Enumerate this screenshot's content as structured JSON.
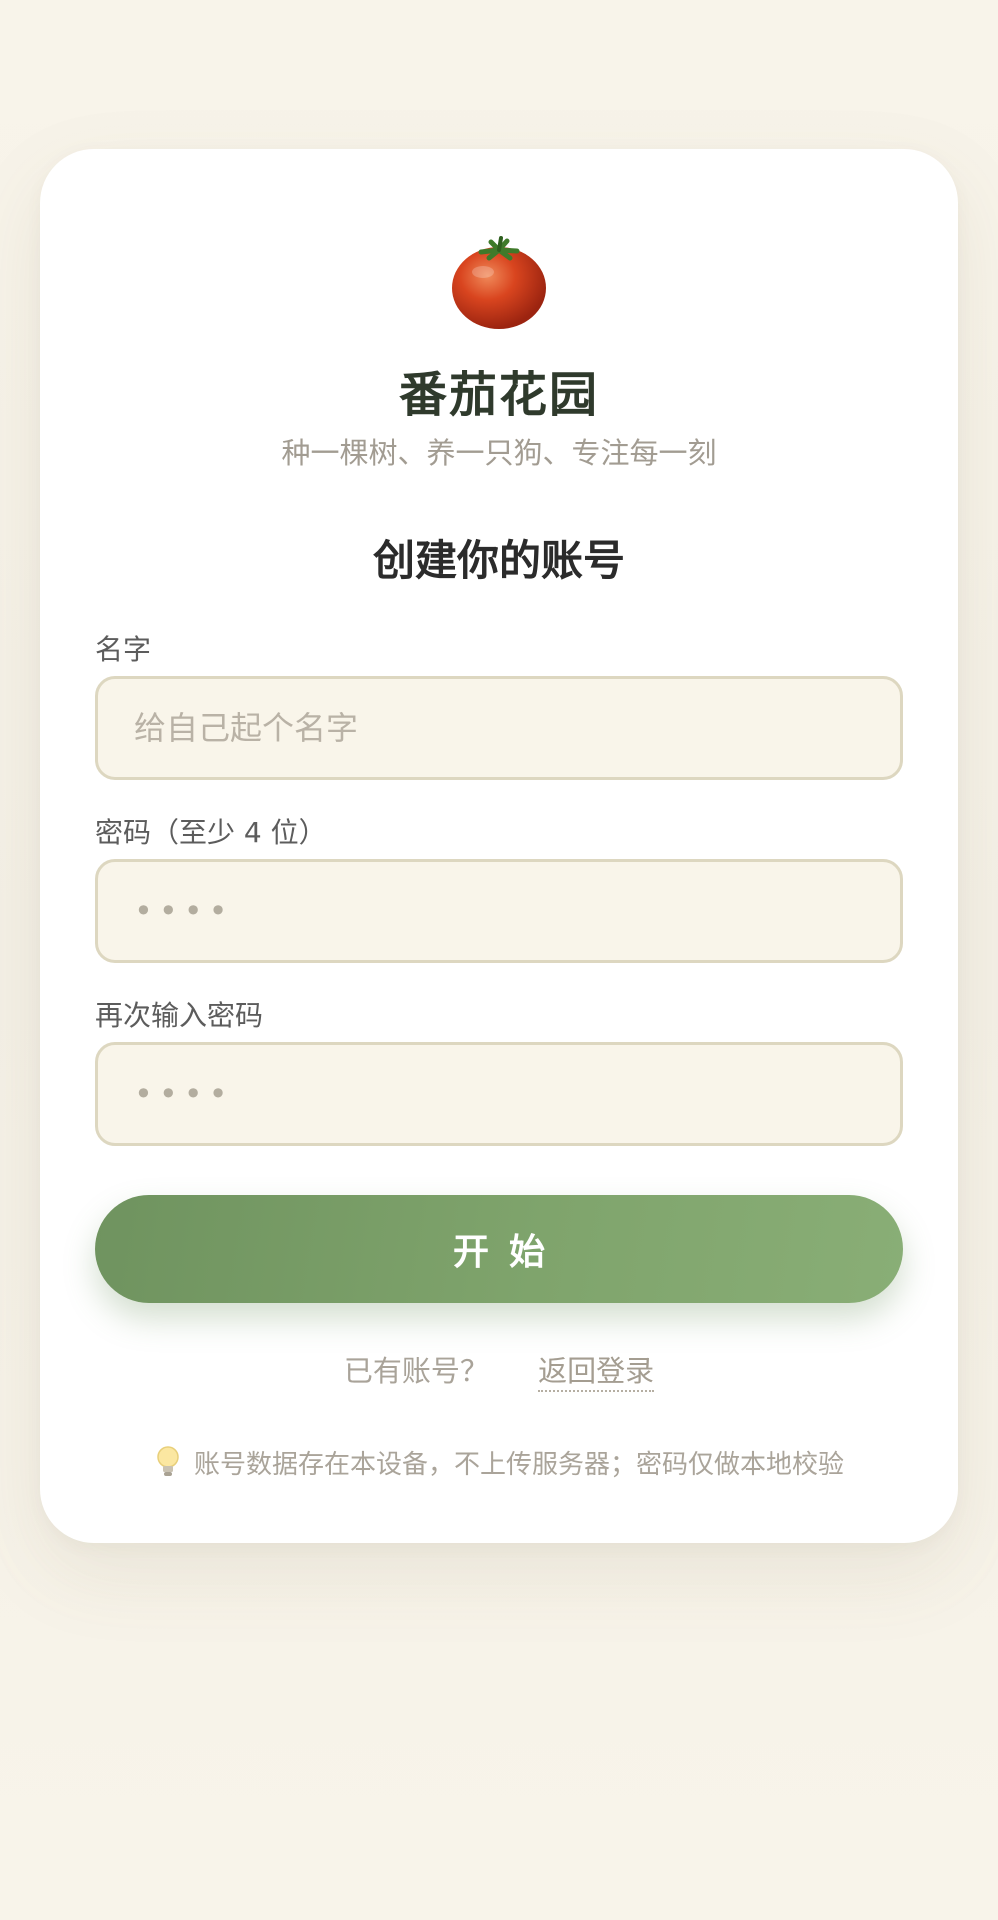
{
  "app": {
    "title": "番茄花园",
    "subtitle": "种一棵树、养一只狗、专注每一刻",
    "logo_icon": "tomato-icon"
  },
  "form": {
    "heading": "创建你的账号",
    "name_label": "名字",
    "name_placeholder": "给自己起个名字",
    "password_label": "密码（至少 4 位）",
    "password_placeholder": "••••",
    "confirm_label": "再次输入密码",
    "confirm_placeholder": "••••",
    "submit_label": "开始"
  },
  "login": {
    "prompt": "已有账号？",
    "link_label": "返回登录"
  },
  "note": {
    "icon": "lightbulb-icon",
    "text": "账号数据存在本设备，不上传服务器；密码仅做本地校验"
  },
  "colors": {
    "accent": "#7a9f68",
    "background": "#f8f4ea",
    "input_bg": "#f9f5ea",
    "input_border": "#ddd7c0"
  }
}
